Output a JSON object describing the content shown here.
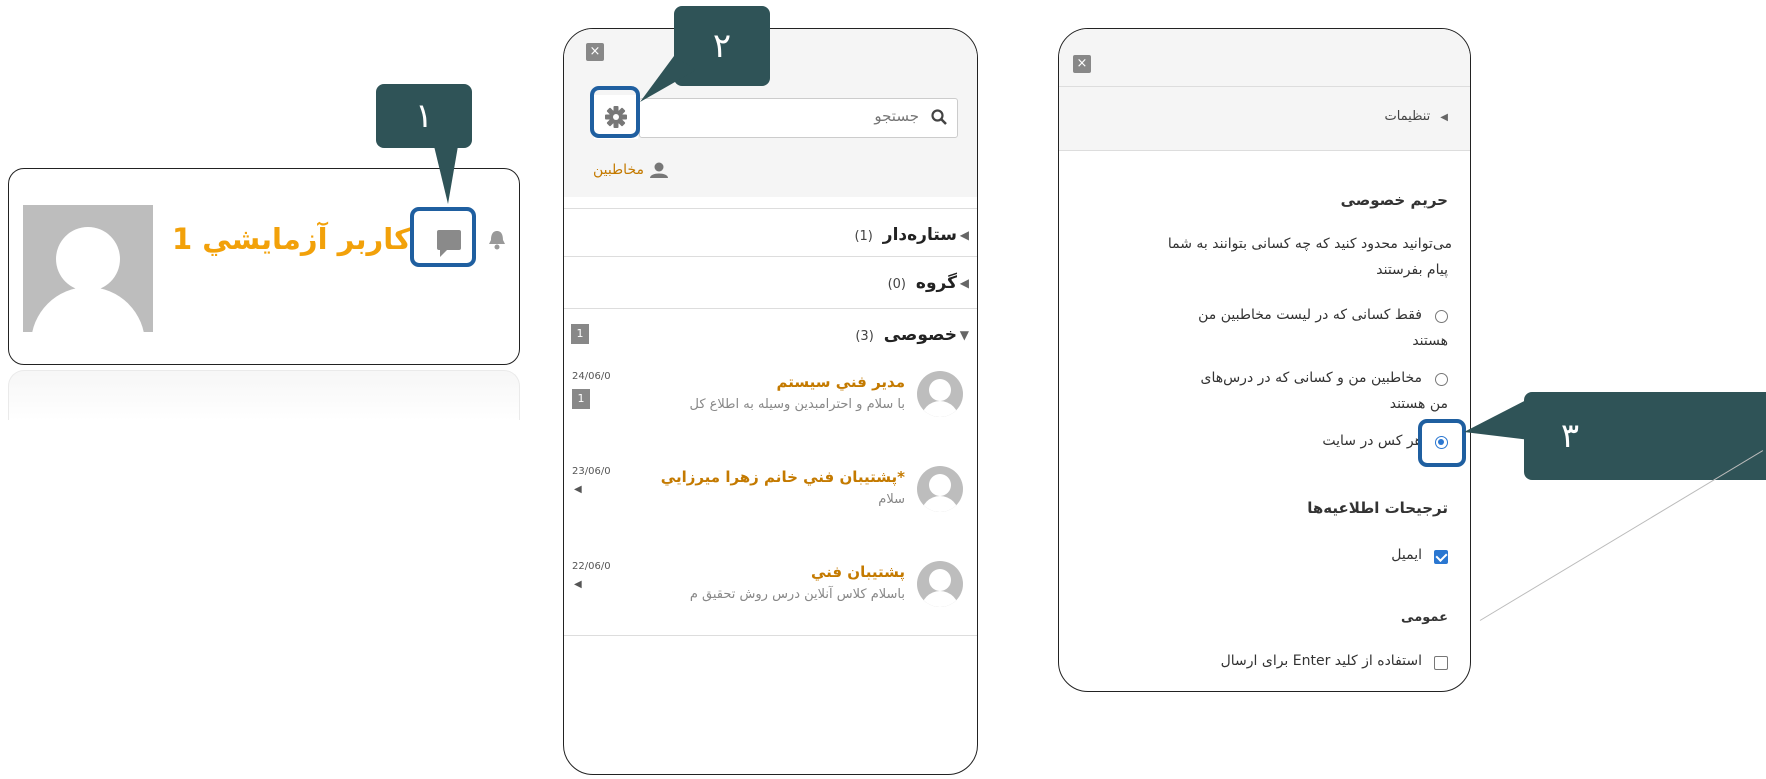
{
  "callouts": {
    "c1": "١",
    "c2": "٢",
    "c3": "٣"
  },
  "profile": {
    "name": "کاربر آزمايشي 1"
  },
  "messages": {
    "close": "×",
    "search_placeholder": "جستجو",
    "contacts_label": "مخاطبین",
    "sections": [
      {
        "label": "ستاره‌دار",
        "count": "(1)"
      },
      {
        "label": "گروه",
        "count": "(0)"
      },
      {
        "label": "خصوصی",
        "count": "(3)",
        "badge": "1"
      }
    ],
    "conversations": [
      {
        "name": "مدير فني سيستم",
        "preview": "با سلام و احترامبدین وسیله به اطلاع کل",
        "date": "24/06/0",
        "badge": "1"
      },
      {
        "name": "*پشتيبان فني خانم زهرا ميرزايي",
        "preview": "سلام",
        "date": "23/06/0"
      },
      {
        "name": "پشتيبان فني",
        "preview": "باسلام کلاس آنلاین درس روش تحقیق م",
        "date": "22/06/0"
      }
    ]
  },
  "settings": {
    "close": "×",
    "settings_label": "تنظیمات",
    "privacy_heading": "حریم خصوصی",
    "privacy_desc_line1": "می‌توانید محدود کنید که چه کسانی بتوانند به شما",
    "privacy_desc_line2": "پیام بفرستند",
    "option1_line1": "فقط کسانی که در لیست مخاطبین من",
    "option1_line2": "هستند",
    "option2_line1": "مخاطبین من و کسانی که در درس‌های",
    "option2_line2": "من هستند",
    "option3": "هر کس در سایت",
    "notif_heading": "ترجیحات اطلاعیه‌ها",
    "email_label": "ایمیل",
    "general_heading": "عمومی",
    "enter_label": "استفاده از کلید Enter برای ارسال"
  },
  "colors": {
    "accent": "#f2a10a",
    "callout": "#2f5357",
    "highlight": "#1f5fa0",
    "link": "#c47a00"
  }
}
